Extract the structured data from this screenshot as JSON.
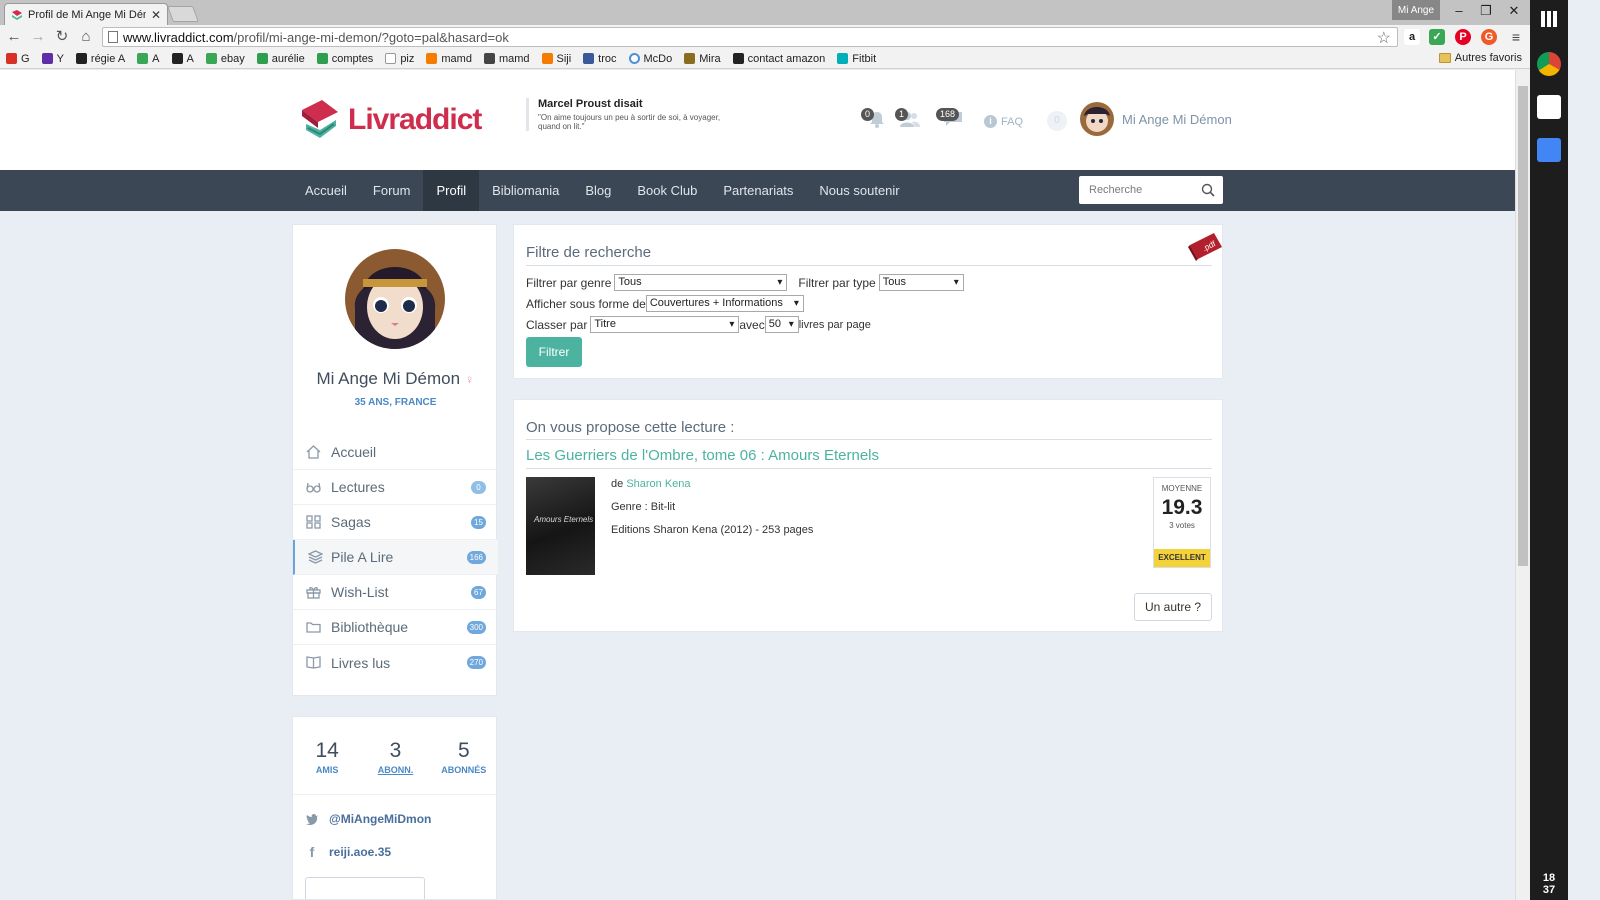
{
  "browser": {
    "tab_title": "Profil de Mi Ange Mi Dém",
    "profile_chip": "Mi Ange",
    "url_host": "www.livraddict.com",
    "url_path": "/profil/mi-ange-mi-demon/?goto=pal&hasard=ok",
    "bookmarks": [
      {
        "label": "G",
        "color": "#d93025"
      },
      {
        "label": "Y",
        "color": "#5f2da8"
      },
      {
        "label": "régie A",
        "color": "#222222"
      },
      {
        "label": "A",
        "color": "#3aa757"
      },
      {
        "label": "A",
        "color": "#222222"
      },
      {
        "label": "ebay",
        "color": "#3aa757"
      },
      {
        "label": "aurélie",
        "color": "#2e9e4f"
      },
      {
        "label": "comptes",
        "color": "#2e9e4f"
      },
      {
        "label": "piz",
        "color": "#cccccc"
      },
      {
        "label": "mamd",
        "color": "#f57c00"
      },
      {
        "label": "mamd",
        "color": "#444444"
      },
      {
        "label": "Siji",
        "color": "#f57c00"
      },
      {
        "label": "troc",
        "color": "#3b5998"
      },
      {
        "label": "McDo",
        "color": "#4a90d9"
      },
      {
        "label": "Mira",
        "color": "#8a6d1f"
      },
      {
        "label": "contact amazon",
        "color": "#222222"
      },
      {
        "label": "Fitbit",
        "color": "#00b0b9"
      }
    ],
    "other_bookmarks": "Autres favoris",
    "clock_hour": "18",
    "clock_min": "37"
  },
  "header": {
    "logo_part1": "Livr",
    "logo_part2": "addict",
    "quote_author": "Marcel Proust disait",
    "quote_text": "\"On aime toujours un peu à sortir de soi, à voyager, quand on lit.\"",
    "notif_count": "0",
    "friends_count": "1",
    "messages_count": "168",
    "faq": "FAQ",
    "coin": "0",
    "username": "Mi Ange Mi Démon"
  },
  "nav": {
    "items": [
      "Accueil",
      "Forum",
      "Profil",
      "Bibliomania",
      "Blog",
      "Book Club",
      "Partenariats",
      "Nous soutenir"
    ],
    "active_index": 2,
    "search_placeholder": "Recherche"
  },
  "profile": {
    "name": "Mi Ange Mi Démon",
    "gender_symbol": "♀",
    "meta": "35 ANS, FRANCE",
    "menu": [
      {
        "label": "Accueil",
        "count": null,
        "icon": "home-icon"
      },
      {
        "label": "Lectures",
        "count": "0",
        "icon": "glasses-icon"
      },
      {
        "label": "Sagas",
        "count": "15",
        "icon": "grid-icon"
      },
      {
        "label": "Pile A Lire",
        "count": "166",
        "icon": "stack-icon"
      },
      {
        "label": "Wish-List",
        "count": "67",
        "icon": "gift-icon"
      },
      {
        "label": "Bibliothèque",
        "count": "300",
        "icon": "folder-icon"
      },
      {
        "label": "Livres lus",
        "count": "270",
        "icon": "book-icon"
      }
    ],
    "active_menu": 3,
    "stats": [
      {
        "value": "14",
        "label": "AMIS"
      },
      {
        "value": "3",
        "label": "ABONN."
      },
      {
        "value": "5",
        "label": "ABONNÉS"
      }
    ],
    "twitter": "@MiAngeMiDmon",
    "facebook": "reiji.aoe.35"
  },
  "filter": {
    "title": "Filtre de recherche",
    "pdf_label": ".pdf",
    "genre_label": "Filtrer par genre",
    "genre_value": "Tous",
    "type_label": "Filtrer par type",
    "type_value": "Tous",
    "display_label": "Afficher sous forme de",
    "display_value": "Couvertures + Informations",
    "sort_label": "Classer par",
    "sort_value": "Titre",
    "with_label": "avec",
    "per_page_value": "50",
    "per_page_label": "livres par page",
    "button": "Filtrer"
  },
  "suggestion": {
    "title": "On vous propose cette lecture :",
    "book_title": "Les Guerriers de l'Ombre, tome 06 : Amours Eternels",
    "cover_text": "Amours Eternels",
    "author_prefix": "de",
    "author": "Sharon Kena",
    "genre": "Genre : Bit-lit",
    "edition": "Editions Sharon Kena (2012) - 253 pages",
    "rating_label": "MOYENNE",
    "rating_value": "19.3",
    "votes": "3 votes",
    "grade": "EXCELLENT",
    "other_button": "Un autre ?"
  }
}
